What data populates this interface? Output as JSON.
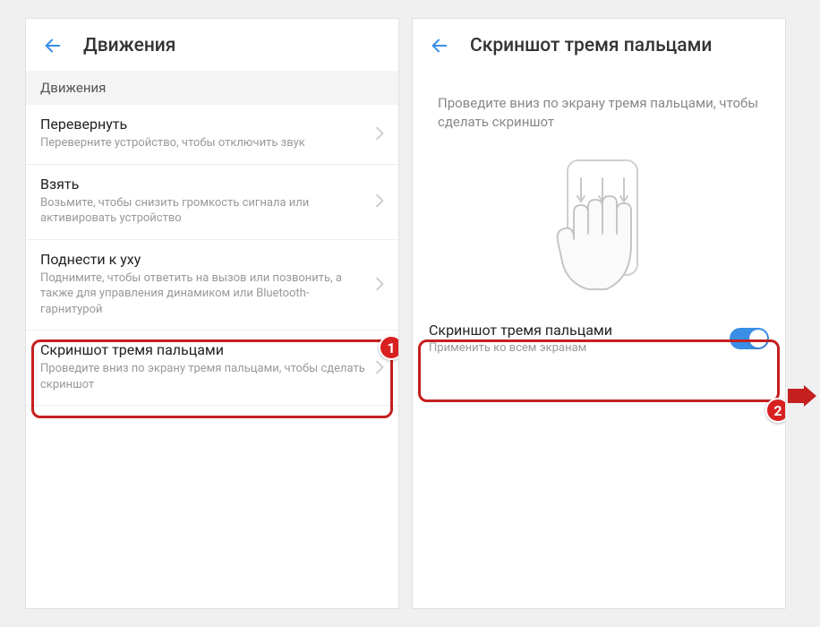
{
  "left": {
    "title": "Движения",
    "section": "Движения",
    "items": [
      {
        "title": "Перевернуть",
        "subtitle": "Переверните устройство, чтобы отключить звук"
      },
      {
        "title": "Взять",
        "subtitle": "Возьмите, чтобы снизить громкость сигнала или активировать устройство"
      },
      {
        "title": "Поднести к уху",
        "subtitle": "Поднимите, чтобы ответить на вызов или позвонить, а также для управления динамиком или Bluetooth-гарнитурой"
      },
      {
        "title": "Скриншот тремя пальцами",
        "subtitle": "Проведите вниз по экрану тремя пальцами, чтобы сделать скриншот"
      }
    ]
  },
  "right": {
    "title": "Скриншот тремя пальцами",
    "description": "Проведите вниз по экрану тремя пальцами, чтобы сделать скриншот",
    "toggle": {
      "title": "Скриншот тремя пальцами",
      "subtitle": "Применить ко всем экранам",
      "on": true
    }
  },
  "badges": {
    "step1": "1",
    "step2": "2"
  }
}
